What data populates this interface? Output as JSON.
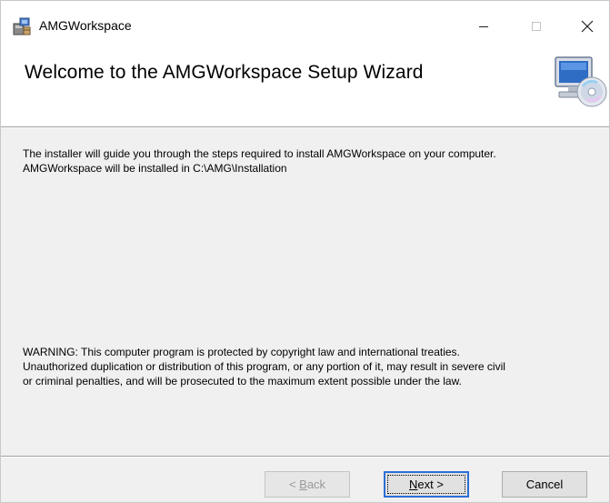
{
  "window": {
    "title": "AMGWorkspace",
    "icons": {
      "app": "installer-icon",
      "minimize": "minimize-icon",
      "maximize": "maximize-icon",
      "close": "close-icon"
    }
  },
  "banner": {
    "title": "Welcome to the AMGWorkspace Setup Wizard",
    "graphic": "computer-cd-icon"
  },
  "body": {
    "intro": [
      "The installer will guide you through the steps required to install AMGWorkspace on your computer.",
      "AMGWorkspace will be installed in C:\\AMG\\Installation"
    ],
    "warning": [
      "WARNING: This computer program is protected by copyright law and international treaties.",
      "Unauthorized duplication or distribution of this program, or any portion of it, may result in severe civil",
      "or criminal penalties, and will be prosecuted to the maximum extent possible under the law."
    ]
  },
  "buttons": {
    "back": {
      "prefix": "< ",
      "mnemonic": "B",
      "rest": "ack",
      "enabled": false
    },
    "next": {
      "mnemonic": "N",
      "rest": "ext >",
      "enabled": true
    },
    "cancel": {
      "label": "Cancel",
      "enabled": true
    }
  },
  "colors": {
    "focus_border": "#2b6fd6",
    "disabled_text": "#9a9a9a"
  }
}
